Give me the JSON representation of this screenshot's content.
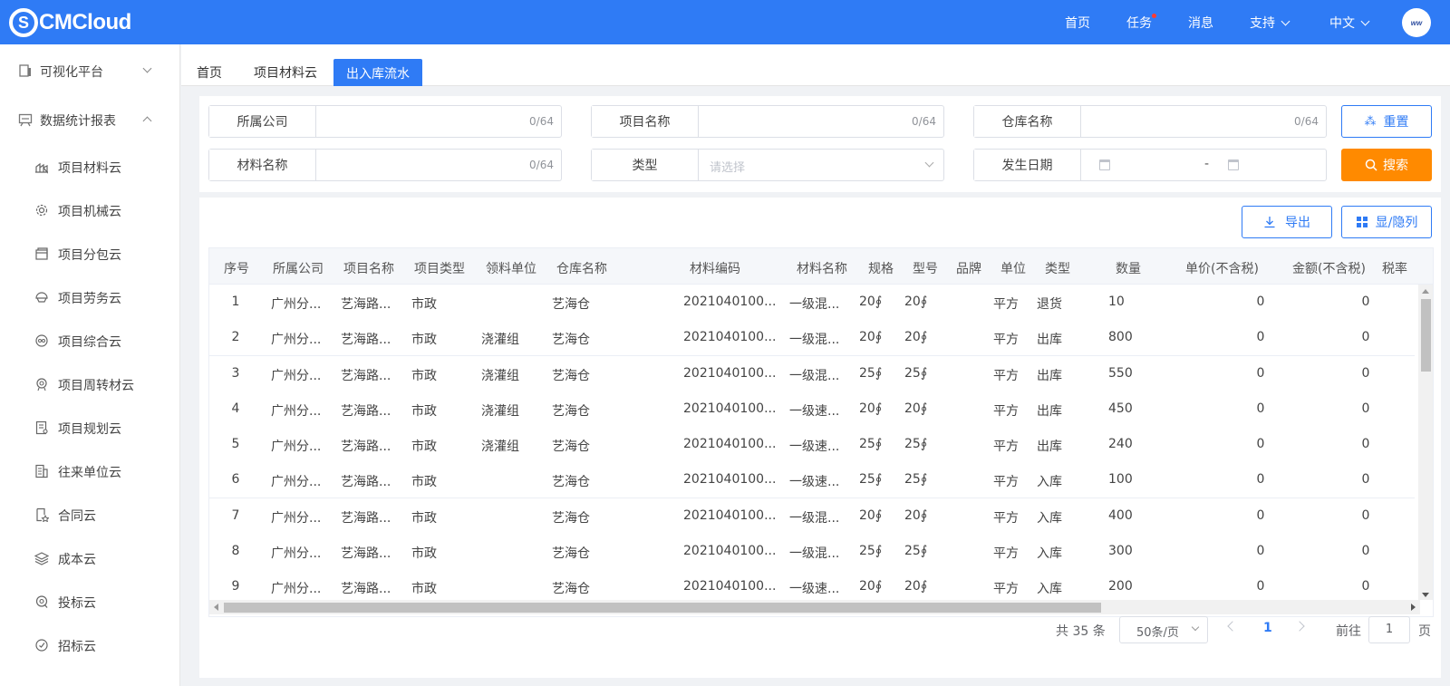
{
  "topbar": {
    "logo_mark": "S",
    "logo_text": "CMCloud",
    "nav": [
      "首页",
      "任务",
      "消息",
      "支持",
      "中文"
    ],
    "avatar_text": "ww"
  },
  "sidebar": {
    "groups": [
      {
        "label": "可视化平台",
        "icon": "monitor-icon",
        "expanded": false
      },
      {
        "label": "数据统计报表",
        "icon": "report-icon",
        "expanded": true
      }
    ],
    "items": [
      {
        "label": "项目材料云",
        "icon": "material-icon"
      },
      {
        "label": "项目机械云",
        "icon": "gear-icon"
      },
      {
        "label": "项目分包云",
        "icon": "package-icon"
      },
      {
        "label": "项目劳务云",
        "icon": "helmet-icon"
      },
      {
        "label": "项目综合云",
        "icon": "composite-icon"
      },
      {
        "label": "项目周转材云",
        "icon": "turnover-icon"
      },
      {
        "label": "项目规划云",
        "icon": "plan-icon"
      },
      {
        "label": "往来单位云",
        "icon": "building-icon"
      },
      {
        "label": "合同云",
        "icon": "contract-icon"
      },
      {
        "label": "成本云",
        "icon": "layers-icon"
      },
      {
        "label": "投标云",
        "icon": "bid-icon"
      },
      {
        "label": "招标云",
        "icon": "tender-icon"
      }
    ]
  },
  "tabs": [
    {
      "label": "首页",
      "active": false
    },
    {
      "label": "项目材料云",
      "active": false
    },
    {
      "label": "出入库流水",
      "active": true
    }
  ],
  "filters": {
    "company": {
      "label": "所属公司",
      "count": "0/64"
    },
    "project": {
      "label": "项目名称",
      "count": "0/64"
    },
    "warehouse": {
      "label": "仓库名称",
      "count": "0/64"
    },
    "material": {
      "label": "材料名称",
      "count": "0/64"
    },
    "type": {
      "label": "类型",
      "placeholder": "请选择"
    },
    "date": {
      "label": "发生日期",
      "separator": "-"
    },
    "reset_label": "重置",
    "search_label": "搜索"
  },
  "toolbar": {
    "export_label": "导出",
    "columns_label": "显/隐列"
  },
  "table": {
    "headers": [
      "序号",
      "所属公司",
      "项目名称",
      "项目类型",
      "领料单位",
      "仓库名称",
      "材料编码",
      "材料名称",
      "规格",
      "型号",
      "品牌",
      "单位",
      "类型",
      "数量",
      "单价(不含税)",
      "金额(不含税)",
      "税率"
    ],
    "rows": [
      [
        "1",
        "广州分...",
        "艺海路...",
        "市政",
        "",
        "艺海仓",
        "2021040100...",
        "一级混...",
        "20∮",
        "20∮",
        "",
        "平方",
        "退货",
        "10",
        "0",
        "0"
      ],
      [
        "2",
        "广州分...",
        "艺海路...",
        "市政",
        "浇灌组",
        "艺海仓",
        "2021040100...",
        "一级混...",
        "20∮",
        "20∮",
        "",
        "平方",
        "出库",
        "800",
        "0",
        "0"
      ],
      [
        "3",
        "广州分...",
        "艺海路...",
        "市政",
        "浇灌组",
        "艺海仓",
        "2021040100...",
        "一级混...",
        "25∮",
        "25∮",
        "",
        "平方",
        "出库",
        "550",
        "0",
        "0"
      ],
      [
        "4",
        "广州分...",
        "艺海路...",
        "市政",
        "浇灌组",
        "艺海仓",
        "2021040100...",
        "一级速...",
        "20∮",
        "20∮",
        "",
        "平方",
        "出库",
        "450",
        "0",
        "0"
      ],
      [
        "5",
        "广州分...",
        "艺海路...",
        "市政",
        "浇灌组",
        "艺海仓",
        "2021040100...",
        "一级速...",
        "25∮",
        "25∮",
        "",
        "平方",
        "出库",
        "240",
        "0",
        "0"
      ],
      [
        "6",
        "广州分...",
        "艺海路...",
        "市政",
        "",
        "艺海仓",
        "2021040100...",
        "一级速...",
        "25∮",
        "25∮",
        "",
        "平方",
        "入库",
        "100",
        "0",
        "0"
      ],
      [
        "7",
        "广州分...",
        "艺海路...",
        "市政",
        "",
        "艺海仓",
        "2021040100...",
        "一级混...",
        "20∮",
        "20∮",
        "",
        "平方",
        "入库",
        "400",
        "0",
        "0"
      ],
      [
        "8",
        "广州分...",
        "艺海路...",
        "市政",
        "",
        "艺海仓",
        "2021040100...",
        "一级混...",
        "25∮",
        "25∮",
        "",
        "平方",
        "入库",
        "300",
        "0",
        "0"
      ],
      [
        "9",
        "广州分...",
        "艺海路...",
        "市政",
        "",
        "艺海仓",
        "2021040100...",
        "一级速...",
        "20∮",
        "20∮",
        "",
        "平方",
        "入库",
        "200",
        "0",
        "0"
      ]
    ]
  },
  "pagination": {
    "total": "共 35 条",
    "page_size": "50条/页",
    "current_page": "1",
    "goto_label": "前往",
    "goto_value": "1",
    "page_suffix": "页"
  },
  "colors": {
    "primary": "#2f7bf5",
    "search_button": "#ff8a00"
  }
}
